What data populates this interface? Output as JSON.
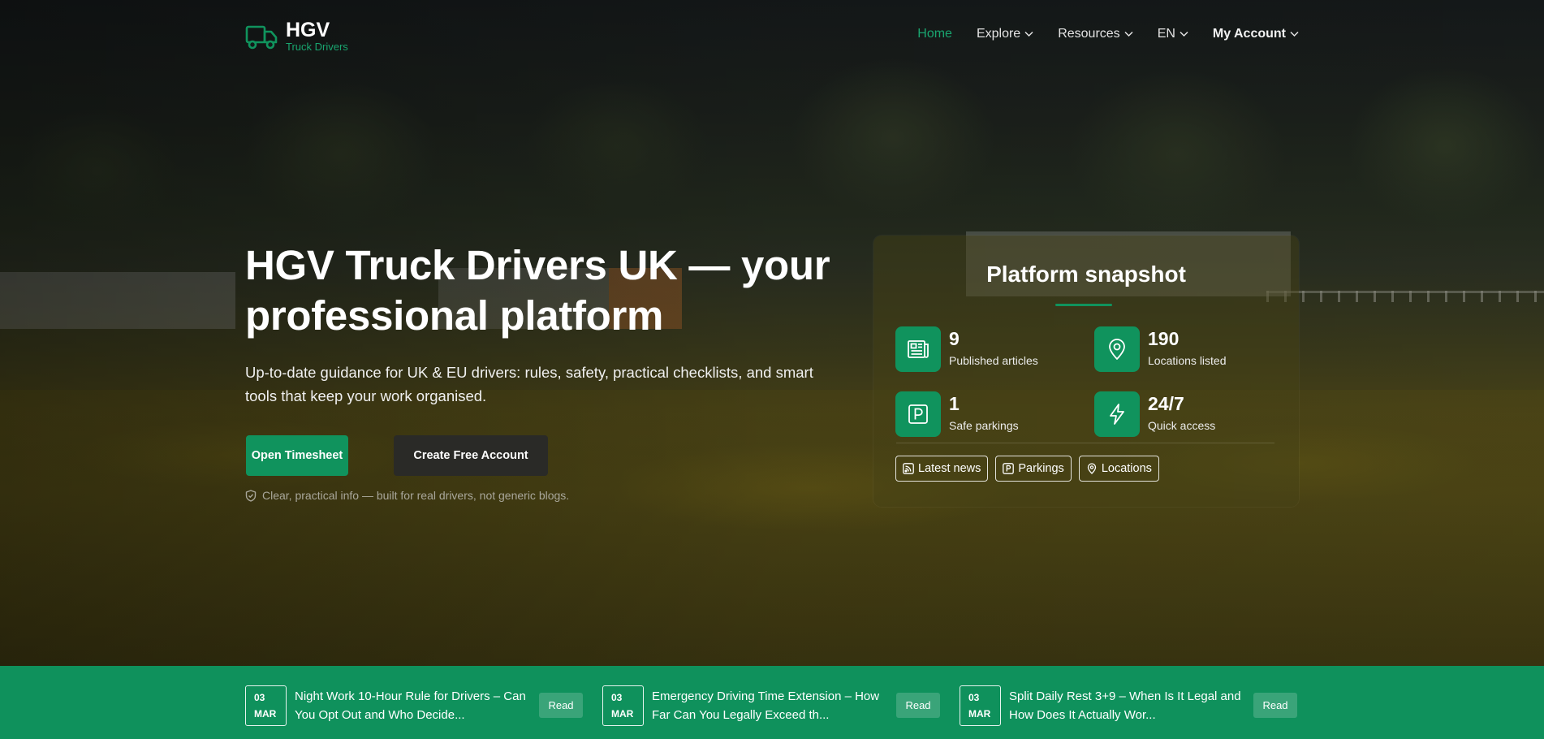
{
  "brand": {
    "name": "HGV",
    "tagline": "Truck Drivers"
  },
  "nav": {
    "items": [
      {
        "label": "Home",
        "active": true,
        "dropdown": false
      },
      {
        "label": "Explore",
        "active": false,
        "dropdown": true
      },
      {
        "label": "Resources",
        "active": false,
        "dropdown": true
      },
      {
        "label": "EN",
        "active": false,
        "dropdown": true
      },
      {
        "label": "My Account",
        "active": false,
        "dropdown": true
      }
    ]
  },
  "hero": {
    "title": "HGV Truck Drivers UK — your professional platform",
    "description": "Up-to-date guidance for UK & EU drivers: rules, safety, practical checklists, and smart tools that keep your work organised.",
    "primary_button": "Open Timesheet",
    "secondary_button": "Create Free Account",
    "note": "Clear, practical info — built for real drivers, not generic blogs."
  },
  "snapshot": {
    "title": "Platform snapshot",
    "stats": [
      {
        "value": "9",
        "label": "Published articles",
        "icon": "newspaper-icon"
      },
      {
        "value": "190",
        "label": "Locations listed",
        "icon": "map-pin-icon"
      },
      {
        "value": "1",
        "label": "Safe parkings",
        "icon": "parking-icon"
      },
      {
        "value": "24/7",
        "label": "Quick access",
        "icon": "lightning-icon"
      }
    ],
    "chips": [
      {
        "label": "Latest news",
        "icon": "rss-icon"
      },
      {
        "label": "Parkings",
        "icon": "parking-icon"
      },
      {
        "label": "Locations",
        "icon": "map-pin-icon"
      }
    ]
  },
  "news": [
    {
      "day": "03",
      "month": "MAR",
      "title": "Night Work 10-Hour Rule for Drivers – Can You Opt Out and Who Decide...",
      "action": "Read"
    },
    {
      "day": "03",
      "month": "MAR",
      "title": "Emergency Driving Time Extension – How Far Can You Legally Exceed th...",
      "action": "Read"
    },
    {
      "day": "03",
      "month": "MAR",
      "title": "Split Daily Rest 3+9 – When Is It Legal and How Does It Actually Wor...",
      "action": "Read"
    }
  ],
  "colors": {
    "accent": "#10935d",
    "accent_text": "#19a56f",
    "dark_button": "#2a2a27"
  }
}
